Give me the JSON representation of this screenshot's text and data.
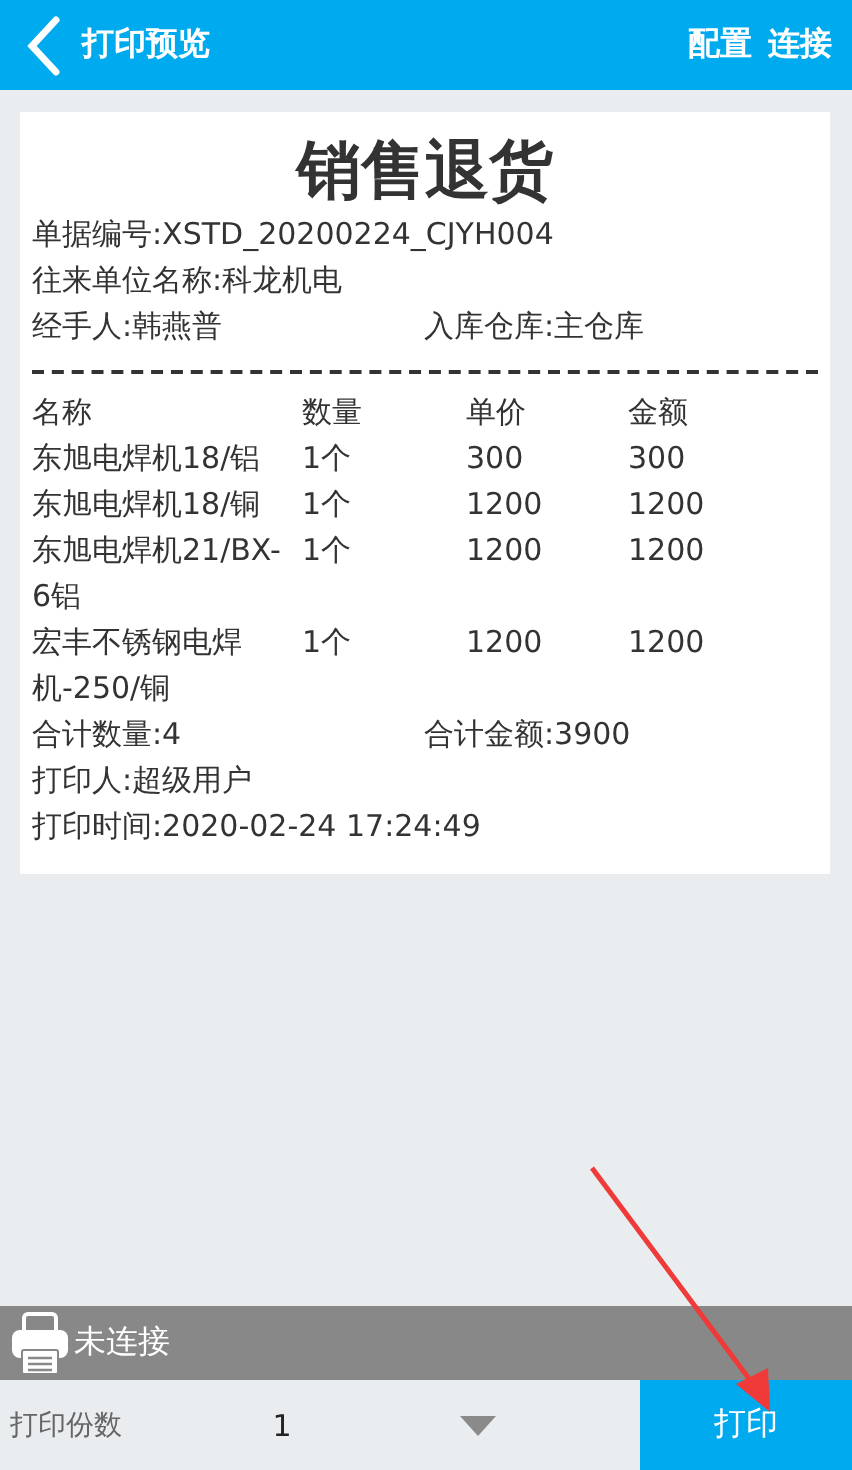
{
  "header": {
    "title": "打印预览",
    "actions": [
      "配置",
      "连接"
    ]
  },
  "receipt": {
    "title": "销售退货",
    "info_lines": [
      [
        "单据编号:XSTD_20200224_CJYH004"
      ],
      [
        "往来单位名称:科龙机电"
      ],
      [
        "经手人:韩燕普",
        "入库仓库:主仓库"
      ]
    ],
    "columns": [
      "名称",
      "数量",
      "单价",
      "金额"
    ],
    "rows": [
      [
        "东旭电焊机18/铝",
        "1个",
        "300",
        "300"
      ],
      [
        "东旭电焊机18/铜",
        "1个",
        "1200",
        "1200"
      ],
      [
        "东旭电焊机21/BX-6铝",
        "1个",
        "1200",
        "1200"
      ],
      [
        "宏丰不锈钢电焊机-250/铜",
        "1个",
        "1200",
        "1200"
      ]
    ],
    "footer_lines": [
      [
        "合计数量:4",
        "合计金额:3900"
      ],
      [
        "打印人:超级用户"
      ],
      [
        "打印时间:2020-02-24 17:24:49"
      ]
    ]
  },
  "printer_status": "未连接",
  "copies": {
    "label": "打印份数",
    "value": "1"
  },
  "print_button": "打印"
}
